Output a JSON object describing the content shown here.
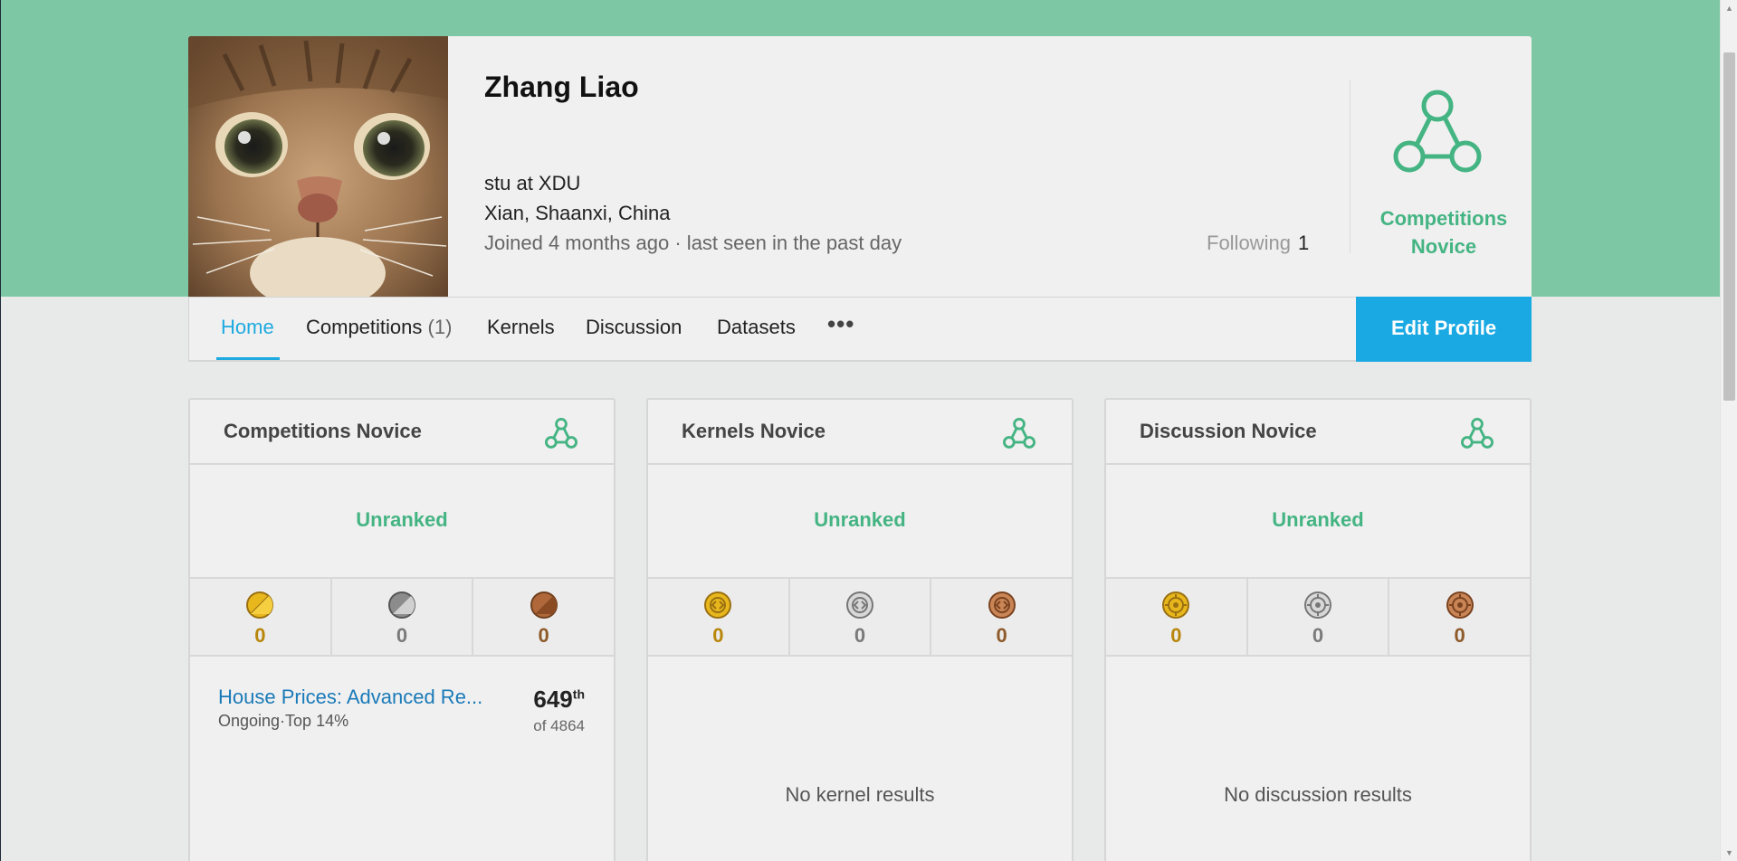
{
  "profile": {
    "name": "Zhang Liao",
    "bio": "stu at XDU",
    "location": "Xian, Shaanxi, China",
    "joined": "Joined 4 months ago · last seen in the past day",
    "following_label": "Following",
    "following_count": "1",
    "tier_line1": "Competitions",
    "tier_line2": "Novice"
  },
  "nav": {
    "home": "Home",
    "competitions": "Competitions",
    "competitions_count": "(1)",
    "kernels": "Kernels",
    "discussion": "Discussion",
    "datasets": "Datasets",
    "more": "•••",
    "edit_profile": "Edit Profile"
  },
  "cards": {
    "competitions": {
      "title": "Competitions Novice",
      "rank": "Unranked",
      "gold": "0",
      "silver": "0",
      "bronze": "0",
      "entry_title": "House Prices: Advanced Re...",
      "entry_status": "Ongoing·Top 14%",
      "entry_rank": "649",
      "entry_rank_suffix": "th",
      "entry_of": "of 4864"
    },
    "kernels": {
      "title": "Kernels Novice",
      "rank": "Unranked",
      "gold": "0",
      "silver": "0",
      "bronze": "0",
      "empty": "No kernel results"
    },
    "discussion": {
      "title": "Discussion Novice",
      "rank": "Unranked",
      "gold": "0",
      "silver": "0",
      "bronze": "0",
      "empty": "No discussion results"
    }
  },
  "colors": {
    "hero_green": "#7ec7a4",
    "tier_green": "#45b483",
    "accent_blue": "#1aa9e3",
    "link_blue": "#1a7ab8",
    "gold": "#e8b71c",
    "silver": "#8c8c8c",
    "bronze": "#b0683a"
  },
  "icons": {
    "tier": "novice-tier-icon",
    "competition_medal": "competition-medal-icon",
    "kernel_medal": "kernel-medal-icon",
    "discussion_medal": "discussion-medal-icon"
  }
}
